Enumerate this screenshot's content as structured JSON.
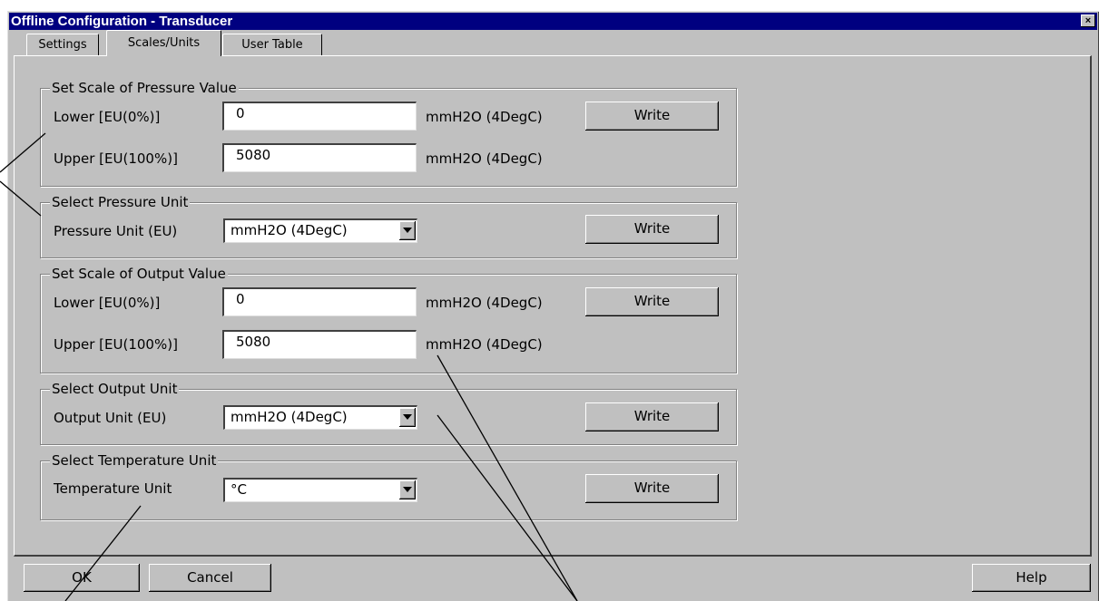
{
  "window": {
    "title": "Offline Configuration - Transducer",
    "close_label": "×"
  },
  "tabs": [
    {
      "label": "Settings"
    },
    {
      "label": "Scales/Units"
    },
    {
      "label": "User Table"
    }
  ],
  "pressure_scale": {
    "title": "Set Scale of Pressure Value",
    "lower_label": "Lower [EU(0%)]",
    "lower_value": "0",
    "lower_unit": "mmH2O (4DegC)",
    "upper_label": "Upper [EU(100%)]",
    "upper_value": "5080",
    "upper_unit": "mmH2O (4DegC)",
    "write_label": "Write"
  },
  "pressure_unit": {
    "title": "Select Pressure Unit",
    "label": "Pressure Unit (EU)",
    "selected": "mmH2O (4DegC)",
    "write_label": "Write"
  },
  "output_scale": {
    "title": "Set Scale of Output Value",
    "lower_label": "Lower [EU(0%)]",
    "lower_value": "0",
    "lower_unit": "mmH2O (4DegC)",
    "upper_label": "Upper [EU(100%)]",
    "upper_value": "5080",
    "upper_unit": "mmH2O (4DegC)",
    "write_label": "Write"
  },
  "output_unit": {
    "title": "Select Output Unit",
    "label": "Output Unit (EU)",
    "selected": "mmH2O (4DegC)",
    "write_label": "Write"
  },
  "temperature_unit": {
    "title": "Select Temperature Unit",
    "label": "Temperature Unit",
    "selected": "°C",
    "write_label": "Write"
  },
  "footer": {
    "ok_label": "OK",
    "cancel_label": "Cancel",
    "help_label": "Help"
  },
  "colors": {
    "titlebar": "#000080",
    "face": "#c0c0c0",
    "shadow": "#808080",
    "highlight": "#ffffff"
  }
}
